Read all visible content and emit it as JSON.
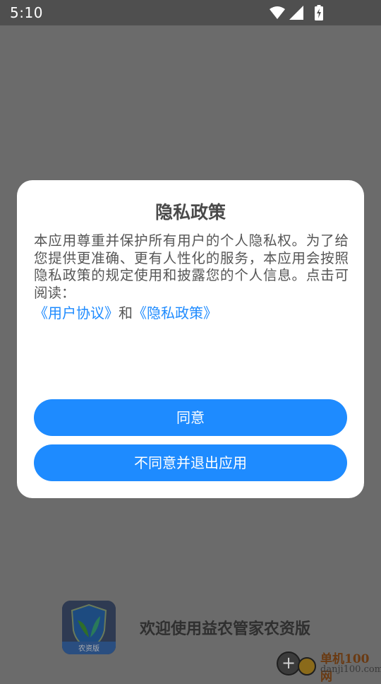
{
  "status_bar": {
    "time": "5:10",
    "icons": [
      "wifi-icon",
      "signal-icon",
      "battery-charging-icon"
    ]
  },
  "dialog": {
    "title": "隐私政策",
    "body": "本应用尊重并保护所有用户的个人隐私权。为了给您提供更准确、更有人性化的服务，本应用会按照隐私政策的规定使用和披露您的个人信息。点击可阅读：",
    "link_user_agreement": "《用户协议》",
    "link_connector": "和",
    "link_privacy_policy": "《隐私政策》",
    "agree_label": "同意",
    "disagree_label": "不同意并退出应用"
  },
  "splash": {
    "logo_text": "农资版",
    "welcome_text": "欢迎使用益农管家农资版"
  },
  "watermark": {
    "top": "单机100网",
    "bottom": "danji100.com"
  },
  "colors": {
    "accent": "#1e8bff",
    "scrim": "#6b6b6b",
    "dialog_bg": "#ffffff"
  }
}
